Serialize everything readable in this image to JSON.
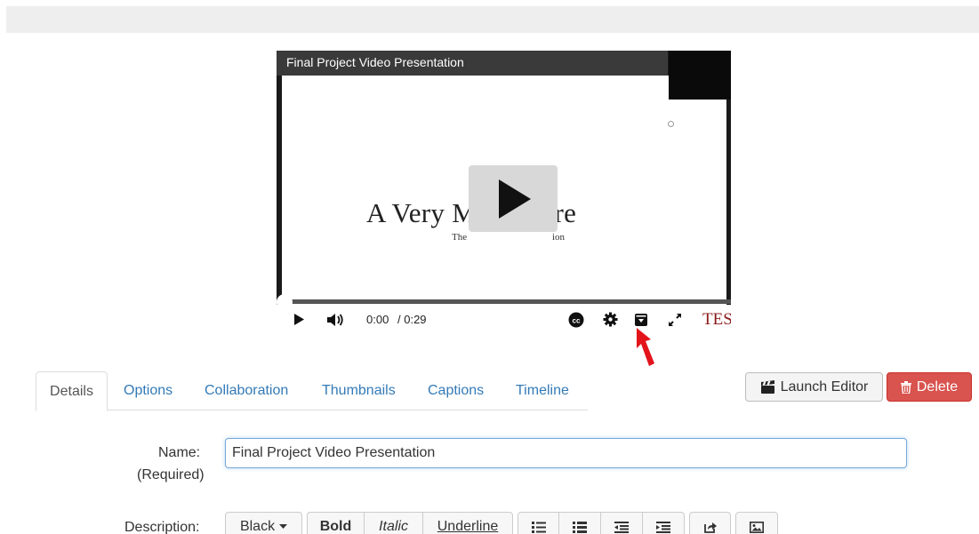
{
  "player": {
    "title": "Final Project Video Presentation",
    "slide_title": "A Very M              lventure",
    "slide_sub_left": "The",
    "slide_sub_right": "ion",
    "current_time": "0:00",
    "duration": "/ 0:29",
    "brand": "TESU",
    "progress": 0
  },
  "tabs": [
    {
      "label": "Details",
      "active": true
    },
    {
      "label": "Options"
    },
    {
      "label": "Collaboration"
    },
    {
      "label": "Thumbnails"
    },
    {
      "label": "Captions"
    },
    {
      "label": "Timeline"
    }
  ],
  "actions": {
    "launch_editor": "Launch Editor",
    "delete": "Delete"
  },
  "form": {
    "name_label": "Name:",
    "required_label": "(Required)",
    "name_value": "Final Project Video Presentation",
    "description_label": "Description:"
  },
  "toolbar": {
    "color": "Black",
    "bold": "Bold",
    "italic": "Italic",
    "underline": "Underline",
    "icons": [
      "unordered-list-icon",
      "ordered-list-icon",
      "outdent-icon",
      "indent-icon",
      "link-icon",
      "image-icon"
    ]
  },
  "colors": {
    "link": "#337ab7",
    "danger": "#d9534f",
    "brand": "#8b1a1a",
    "annotation_arrow": "#e3141b"
  }
}
